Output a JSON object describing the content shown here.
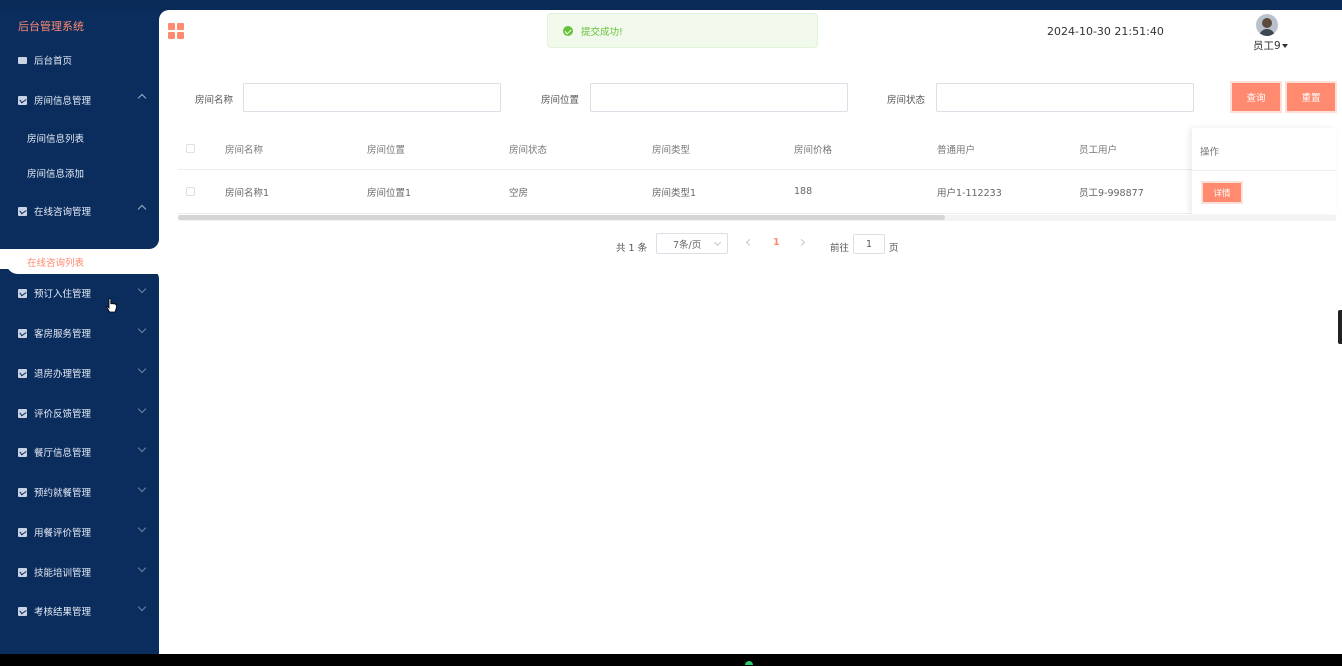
{
  "app": {
    "title": "后台管理系统"
  },
  "sidebar": {
    "home": "后台首页",
    "room_mgmt": "房间信息管理",
    "room_list": "房间信息列表",
    "room_add": "房间信息添加",
    "consult_mgmt": "在线咨询管理",
    "consult_list": "在线咨询列表",
    "items": [
      {
        "label": "预订入住管理"
      },
      {
        "label": "客房服务管理"
      },
      {
        "label": "退房办理管理"
      },
      {
        "label": "评价反馈管理"
      },
      {
        "label": "餐厅信息管理"
      },
      {
        "label": "预约就餐管理"
      },
      {
        "label": "用餐评价管理"
      },
      {
        "label": "技能培训管理"
      },
      {
        "label": "考核结果管理"
      }
    ]
  },
  "header": {
    "toast": "提交成功!",
    "datetime": "2024-10-30 21:51:40",
    "username": "员工9"
  },
  "search": {
    "room_name_label": "房间名称",
    "room_location_label": "房间位置",
    "room_status_label": "房间状态",
    "query_btn": "查询",
    "reset_btn": "重置"
  },
  "table": {
    "headers": [
      "房间名称",
      "房间位置",
      "房间状态",
      "房间类型",
      "房间价格",
      "普通用户",
      "员工用户",
      "操作"
    ],
    "rows": [
      {
        "cells": [
          "房间名称1",
          "房间位置1",
          "空房",
          "房间类型1",
          "188",
          "用户1-112233",
          "员工9-998877"
        ],
        "action": "详情"
      }
    ]
  },
  "pagination": {
    "total": "共 1 条",
    "page_size": "7条/页",
    "current": "1",
    "goto_label": "前往",
    "goto_value": "1",
    "page_suffix": "页"
  },
  "colors": {
    "accent": "#ff8a70",
    "sidebar_bg": "#0b2d5e",
    "success": "#67c23a"
  }
}
